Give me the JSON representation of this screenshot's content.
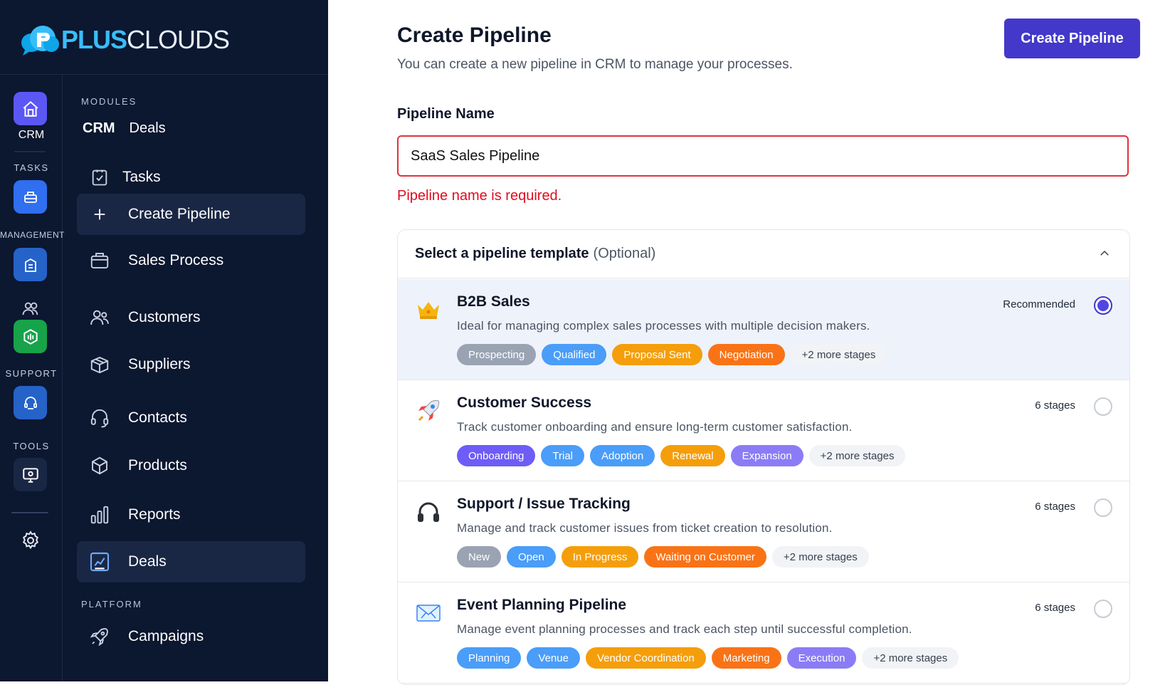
{
  "brand": {
    "part1": "PLUS",
    "part2": "CLOUDS"
  },
  "rail": {
    "crm": "CRM",
    "tasks": "TASKS",
    "management": "MANAGEMENT",
    "support": "SUPPORT",
    "tools": "TOOLS"
  },
  "nav": {
    "modules_label": "MODULES",
    "crm": "CRM",
    "crm_deals": "Deals",
    "items": [
      "Tasks",
      "Create Pipeline",
      "Sales Process",
      "Customers",
      "Suppliers",
      "Contacts",
      "Products",
      "Reports",
      "Deals"
    ],
    "platform_label": "PLATFORM",
    "campaigns": "Campaigns"
  },
  "page": {
    "title": "Create Pipeline",
    "subtitle": "You can create a new pipeline in CRM to manage your processes.",
    "create_button": "Create Pipeline",
    "name_label": "Pipeline Name",
    "name_value": "SaaS Sales Pipeline",
    "name_error": "Pipeline name is required."
  },
  "templates": {
    "title": "Select a pipeline template",
    "optional": "(Optional)",
    "items": [
      {
        "name": "B2B Sales",
        "icon": "crown-icon",
        "desc": "Ideal for managing complex sales processes with multiple decision makers.",
        "meta": "Recommended",
        "selected": true,
        "tags": [
          {
            "label": "Prospecting",
            "color": "#9aa3b2"
          },
          {
            "label": "Qualified",
            "color": "#4a9df8"
          },
          {
            "label": "Proposal Sent",
            "color": "#f59e0b"
          },
          {
            "label": "Negotiation",
            "color": "#f97316"
          }
        ],
        "more": "+2 more stages"
      },
      {
        "name": "Customer Success",
        "icon": "rocket-icon",
        "desc": "Track customer onboarding and ensure long-term customer satisfaction.",
        "meta": "6 stages",
        "selected": false,
        "tags": [
          {
            "label": "Onboarding",
            "color": "#6d5df6"
          },
          {
            "label": "Trial",
            "color": "#4a9df8"
          },
          {
            "label": "Adoption",
            "color": "#4a9df8"
          },
          {
            "label": "Renewal",
            "color": "#f59e0b"
          },
          {
            "label": "Expansion",
            "color": "#8b7cf6"
          }
        ],
        "more": "+2 more stages"
      },
      {
        "name": "Support / Issue Tracking",
        "icon": "headphones-icon",
        "desc": "Manage and track customer issues from ticket creation to resolution.",
        "meta": "6 stages",
        "selected": false,
        "tags": [
          {
            "label": "New",
            "color": "#9aa3b2"
          },
          {
            "label": "Open",
            "color": "#4a9df8"
          },
          {
            "label": "In Progress",
            "color": "#f59e0b"
          },
          {
            "label": "Waiting on Customer",
            "color": "#f97316"
          }
        ],
        "more": "+2 more stages"
      },
      {
        "name": "Event Planning Pipeline",
        "icon": "event-icon",
        "desc": "Manage event planning processes and track each step until successful completion.",
        "meta": "6 stages",
        "selected": false,
        "tags": [
          {
            "label": "Planning",
            "color": "#4a9df8"
          },
          {
            "label": "Venue",
            "color": "#4a9df8"
          },
          {
            "label": "Vendor Coordination",
            "color": "#f59e0b"
          },
          {
            "label": "Marketing",
            "color": "#f97316"
          },
          {
            "label": "Execution",
            "color": "#8b7cf6"
          }
        ],
        "more": "+2 more stages"
      }
    ]
  }
}
